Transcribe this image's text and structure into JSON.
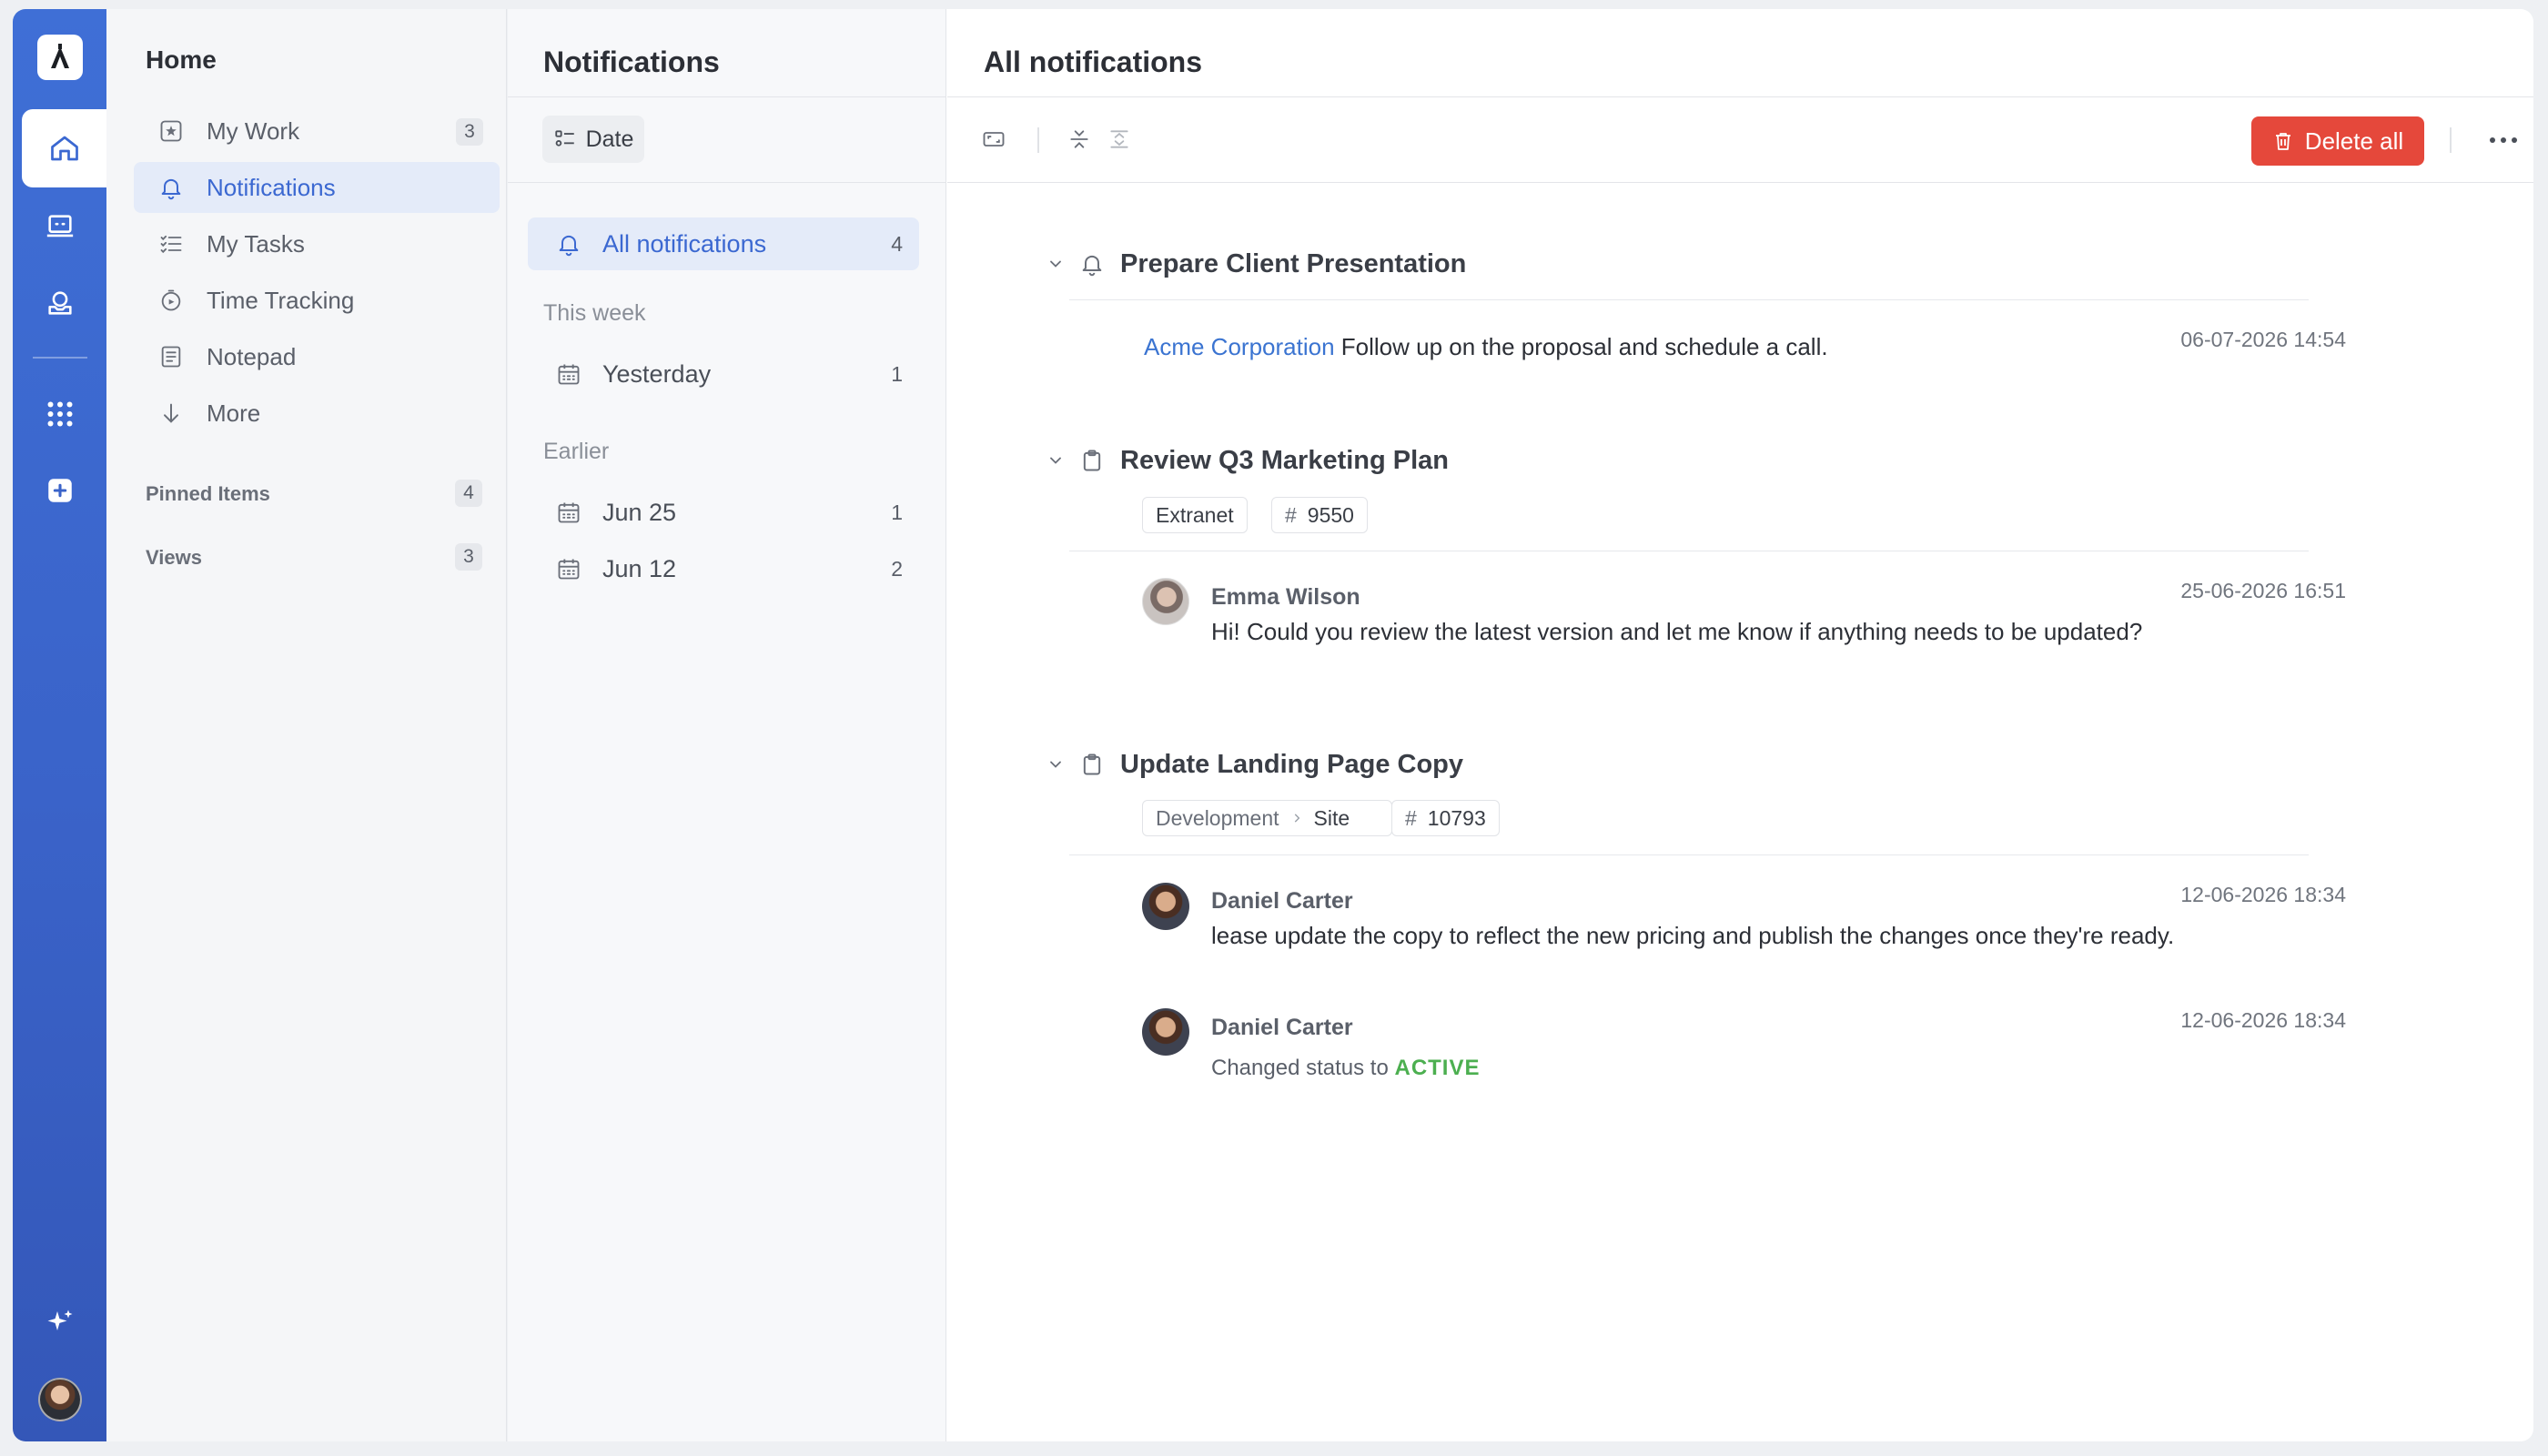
{
  "sidebar": {
    "title": "Home",
    "items": [
      {
        "label": "My Work",
        "count": "3"
      },
      {
        "label": "Notifications",
        "count": ""
      },
      {
        "label": "My Tasks",
        "count": ""
      },
      {
        "label": "Time Tracking",
        "count": ""
      },
      {
        "label": "Notepad",
        "count": ""
      },
      {
        "label": "More",
        "count": ""
      }
    ],
    "sections": [
      {
        "label": "Pinned Items",
        "count": "4"
      },
      {
        "label": "Views",
        "count": "3"
      }
    ]
  },
  "filters": {
    "title": "Notifications",
    "group_by_label": "Date",
    "all": {
      "label": "All notifications",
      "count": "4"
    },
    "this_week_heading": "This week",
    "this_week": [
      {
        "label": "Yesterday",
        "count": "1"
      }
    ],
    "earlier_heading": "Earlier",
    "earlier": [
      {
        "label": "Jun 25",
        "count": "1"
      },
      {
        "label": "Jun 12",
        "count": "2"
      }
    ]
  },
  "main": {
    "title": "All notifications",
    "delete_all_label": "Delete all",
    "groups": [
      {
        "title": "Prepare Client Presentation",
        "icon": "bell-icon",
        "entries": [
          {
            "link": "Acme Corporation",
            "text": "Follow up on the proposal and schedule a call.",
            "time": "06-07-2026 14:54"
          }
        ]
      },
      {
        "title": "Review Q3 Marketing Plan",
        "icon": "clipboard-icon",
        "tags": {
          "project": "Extranet",
          "id": "9550"
        },
        "entries": [
          {
            "author": "Emma Wilson",
            "text": "Hi! Could you review the latest version and let me know if anything needs to be updated?",
            "time": "25-06-2026 16:51"
          }
        ]
      },
      {
        "title": "Update Landing Page Copy",
        "icon": "clipboard-icon",
        "tags": {
          "path_parent": "Development",
          "path_child": "Site",
          "id": "10793"
        },
        "entries": [
          {
            "author": "Daniel Carter",
            "text": "lease update the copy to reflect the new pricing and publish the changes once they're ready.",
            "time": "12-06-2026 18:34"
          },
          {
            "author": "Daniel Carter",
            "status_prefix": "Changed status to",
            "status_value": "ACTIVE",
            "time": "12-06-2026 18:34"
          }
        ]
      }
    ]
  },
  "colors": {
    "accent": "#3b68d1",
    "rail": "#3a63c9",
    "danger": "#e5483b",
    "status_active": "#4caf50"
  }
}
